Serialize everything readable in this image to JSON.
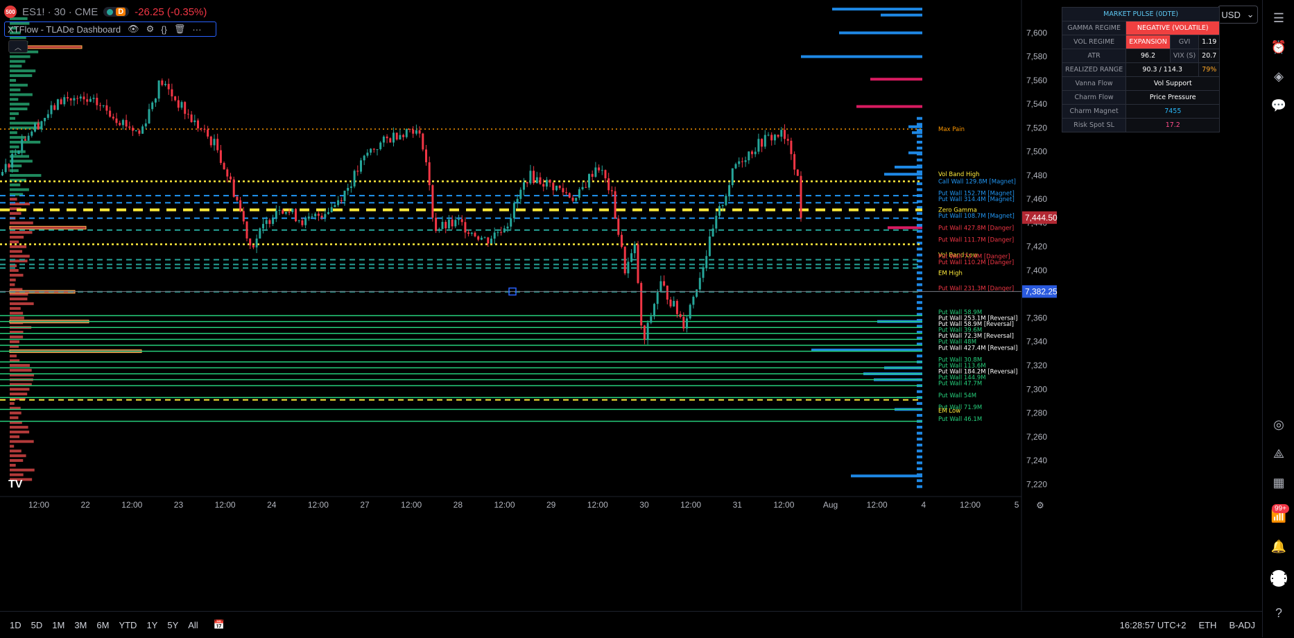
{
  "header": {
    "badge": "500",
    "symbol": "ES1! · 30 · CME",
    "session": "D",
    "change": "-26.25 (-0.35%)"
  },
  "indicator": {
    "name": "XTFlow - TLADe Dashboard",
    "icons": [
      "eye-icon",
      "settings-icon",
      "source-code-icon",
      "delete-icon",
      "more-icon"
    ]
  },
  "currency": "USD",
  "market_pulse": {
    "title": "MARKET PULSE (0DTE)",
    "gamma_regime_label": "GAMMA REGIME",
    "gamma_regime_value": "NEGATIVE (VOLATILE)",
    "vol_regime_label": "VOL REGIME",
    "vol_regime_value": "EXPANSION",
    "gvi_label": "GVI",
    "gvi_value": "1.19",
    "atr_label": "ATR",
    "atr_value": "96.2",
    "vix_label": "VIX (S)",
    "vix_value": "20.7",
    "realized_label": "REALIZED RANGE",
    "realized_value": "90.3 / 114.3",
    "realized_pct": "79%",
    "vanna_label": "Vanna Flow",
    "vanna_value": "Vol Support",
    "charm_label": "Charm Flow",
    "charm_value": "Price Pressure",
    "magnet_label": "Charm Magnet",
    "magnet_value": "7455",
    "risk_label": "Risk Spot SL",
    "risk_value": "17.2"
  },
  "price_axis": {
    "ticks": [
      7600,
      7580,
      7560,
      7540,
      7520,
      7500,
      7480,
      7460,
      7440,
      7420,
      7400,
      7380,
      7360,
      7340,
      7320,
      7300,
      7280,
      7260,
      7240,
      7220
    ],
    "current_price": "7,444.50",
    "crosshair_price": "7,382.25",
    "min": 7212,
    "max": 7623
  },
  "time_axis": {
    "labels": [
      "12:00",
      "22",
      "12:00",
      "23",
      "12:00",
      "24",
      "12:00",
      "27",
      "12:00",
      "28",
      "12:00",
      "29",
      "12:00",
      "30",
      "12:00",
      "31",
      "12:00",
      "Aug",
      "12:00",
      "4",
      "12:00",
      "5"
    ]
  },
  "level_labels": [
    {
      "price": 7519,
      "text": "Max Pain",
      "color": "#ff9800"
    },
    {
      "price": 7481,
      "text": "Vol Band High",
      "color": "#ffeb3b"
    },
    {
      "price": 7475,
      "text": "Call Wall 129.8M [Magnet]",
      "color": "#2196f3"
    },
    {
      "price": 7465,
      "text": "Put Wall 152.7M [Magnet]",
      "color": "#2196f3"
    },
    {
      "price": 7460,
      "text": "Put Wall 314.4M [Magnet]",
      "color": "#2196f3"
    },
    {
      "price": 7451,
      "text": "Zero Gamma",
      "color": "#ffeb3b"
    },
    {
      "price": 7446,
      "text": "Put Wall 108.7M [Magnet]",
      "color": "#2196f3"
    },
    {
      "price": 7436,
      "text": "Put Wall 427.8M [Danger]",
      "color": "#f23645"
    },
    {
      "price": 7426,
      "text": "Put Wall 111.7M [Danger]",
      "color": "#f23645"
    },
    {
      "price": 7413,
      "text": "Vol Band Low",
      "color": "#ffeb3b"
    },
    {
      "price": 7412,
      "text": "Put Wall 73.4M [Danger]",
      "color": "#f23645"
    },
    {
      "price": 7407,
      "text": "Put Wall 110.2M [Danger]",
      "color": "#f23645"
    },
    {
      "price": 7398,
      "text": "EM High",
      "color": "#ffeb3b"
    },
    {
      "price": 7385,
      "text": "Put Wall 231.3M [Danger]",
      "color": "#f23645"
    },
    {
      "price": 7365,
      "text": "Put Wall 58.9M",
      "color": "#26d07c"
    },
    {
      "price": 7360,
      "text": "Put Wall 253.1M [Reversal]",
      "color": "#ffffff"
    },
    {
      "price": 7355,
      "text": "Put Wall 58.9M [Reversal]",
      "color": "#ffffff"
    },
    {
      "price": 7350,
      "text": "Put Wall 39.6M",
      "color": "#26d07c"
    },
    {
      "price": 7345,
      "text": "Put Wall 72.3M [Reversal]",
      "color": "#ffffff"
    },
    {
      "price": 7340,
      "text": "Put Wall 48M",
      "color": "#26d07c"
    },
    {
      "price": 7335,
      "text": "Put Wall 427.4M [Reversal]",
      "color": "#ffffff"
    },
    {
      "price": 7325,
      "text": "Put Wall 30.8M",
      "color": "#26d07c"
    },
    {
      "price": 7320,
      "text": "Put Wall 113.6M",
      "color": "#26d07c"
    },
    {
      "price": 7315,
      "text": "Put Wall 184.2M [Reversal]",
      "color": "#ffffff"
    },
    {
      "price": 7310,
      "text": "Put Wall 144.9M",
      "color": "#26d07c"
    },
    {
      "price": 7305,
      "text": "Put Wall 47.7M",
      "color": "#26d07c"
    },
    {
      "price": 7295,
      "text": "Put Wall 54M",
      "color": "#26d07c"
    },
    {
      "price": 7285,
      "text": "Put Wall 71.9M",
      "color": "#26d07c"
    },
    {
      "price": 7282,
      "text": "EM Low",
      "color": "#ffeb3b"
    },
    {
      "price": 7275,
      "text": "Put Wall 46.1M",
      "color": "#26d07c"
    }
  ],
  "timeframes": [
    "1D",
    "5D",
    "1M",
    "3M",
    "6M",
    "YTD",
    "1Y",
    "5Y",
    "All"
  ],
  "status": {
    "time": "16:28:57 UTC+2",
    "session": "ETH",
    "adj": "B-ADJ"
  },
  "notifications": "99+",
  "colors": {
    "up": "#26a69a",
    "down": "#f23645",
    "wall_green": "#26d07c",
    "zero_gamma": "#ffeb3b",
    "call_wall": "#2196f3"
  }
}
